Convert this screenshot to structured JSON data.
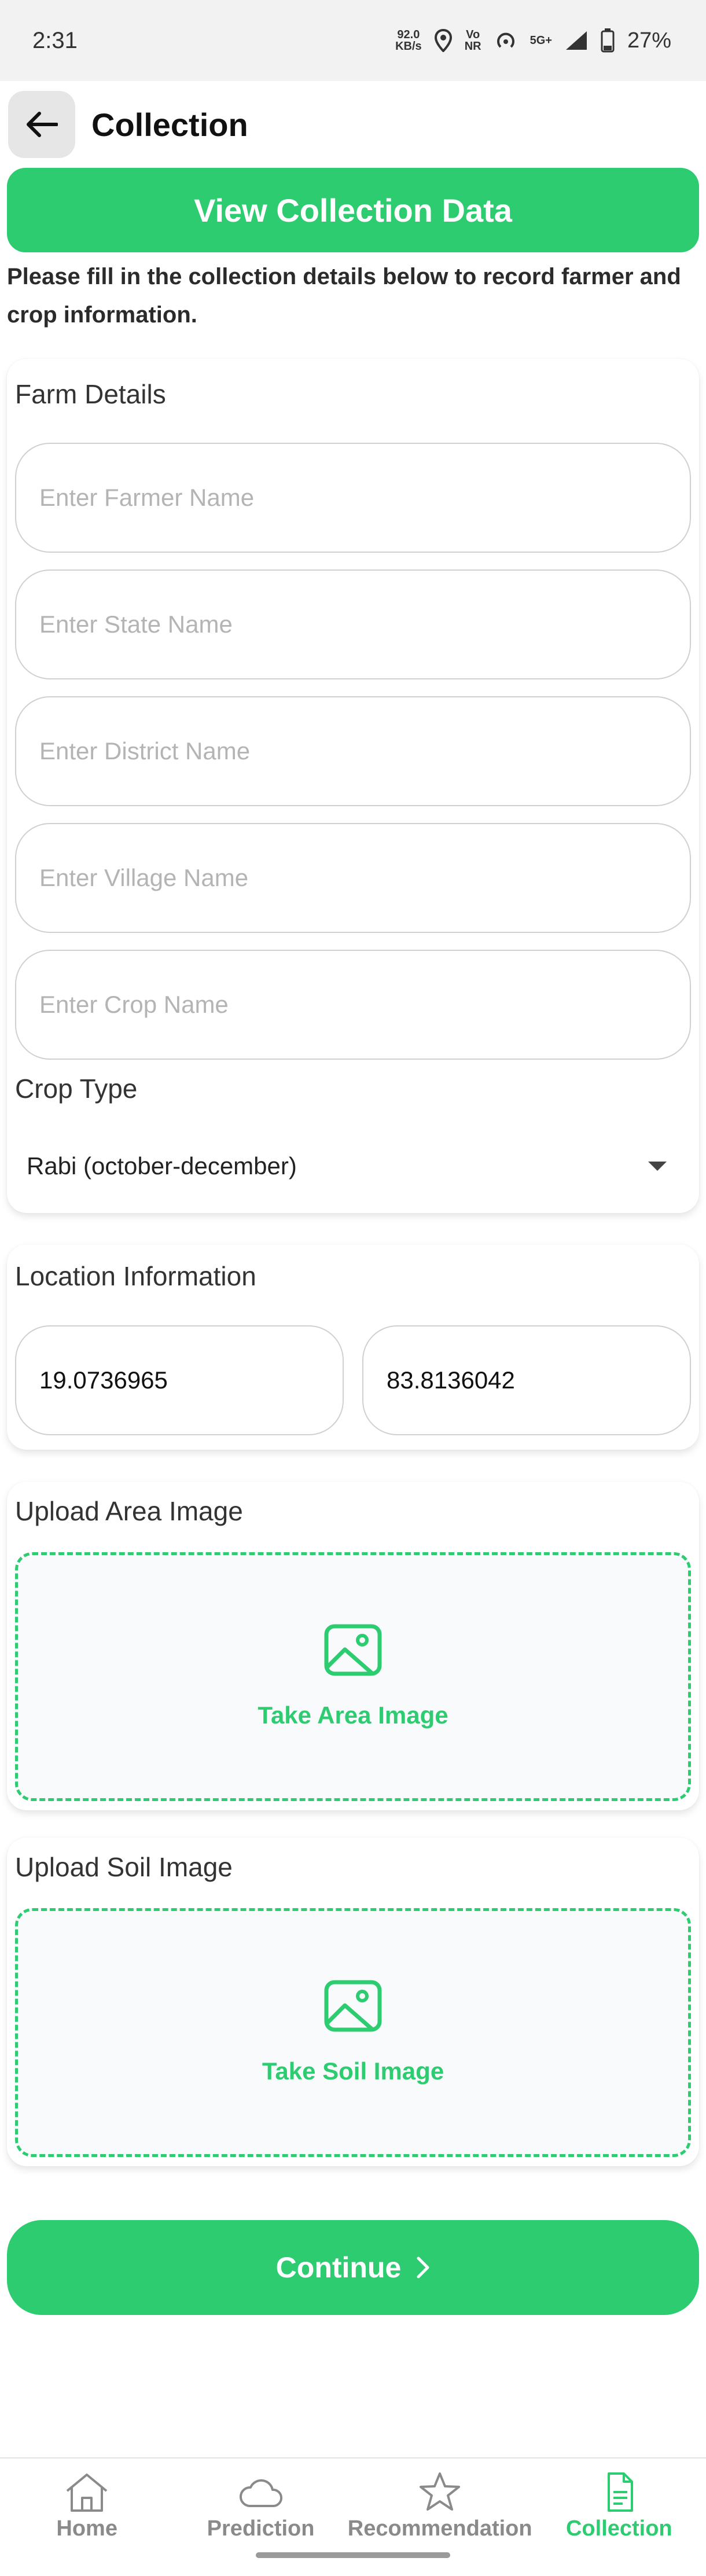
{
  "status_bar": {
    "time": "2:31",
    "net_speed": "92.0",
    "net_unit": "KB/s",
    "volte": "Vo",
    "volte_sub": "NR",
    "signal": "5G+",
    "battery": "27%"
  },
  "header": {
    "title": "Collection"
  },
  "view_button_label": "View Collection Data",
  "intro_text": "Please fill in the collection details below to record farmer and crop information.",
  "farm_details": {
    "title": "Farm Details",
    "farmer_placeholder": "Enter Farmer Name",
    "state_placeholder": "Enter State Name",
    "district_placeholder": "Enter District Name",
    "village_placeholder": "Enter Village Name",
    "crop_placeholder": "Enter Crop Name",
    "crop_type_label": "Crop Type",
    "crop_type_value": "Rabi (october-december)"
  },
  "location": {
    "title": "Location Information",
    "latitude": "19.0736965",
    "longitude": "83.8136042"
  },
  "area_image": {
    "title": "Upload Area Image",
    "action": "Take Area Image",
    "icon": "image-icon"
  },
  "soil_image": {
    "title": "Upload Soil Image",
    "action": "Take Soil Image",
    "icon": "image-icon"
  },
  "continue_label": "Continue",
  "nav": {
    "items": [
      {
        "label": "Home",
        "icon": "home-icon"
      },
      {
        "label": "Prediction",
        "icon": "cloud-icon"
      },
      {
        "label": "Recommendation",
        "icon": "star-icon"
      },
      {
        "label": "Collection",
        "icon": "document-icon"
      }
    ]
  },
  "colors": {
    "accent": "#2ecc71",
    "inactive": "#8a8a8a"
  }
}
